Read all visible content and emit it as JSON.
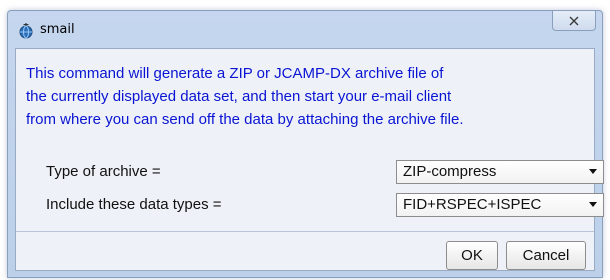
{
  "window": {
    "title": "smail",
    "close_icon": "close-x-icon",
    "app_icon": "smail-globe-icon"
  },
  "message": {
    "lines": [
      "This command will generate a ZIP or JCAMP-DX archive file of",
      "the currently displayed data set, and then start your e-mail client",
      "from where you can send off the data by attaching the archive file."
    ],
    "color": "#0a14d2"
  },
  "fields": {
    "archive_type": {
      "label": "Type of archive =",
      "value": "ZIP-compress"
    },
    "data_types": {
      "label": "Include these data types =",
      "value": "FID+RSPEC+ISPEC"
    }
  },
  "buttons": {
    "ok": "OK",
    "cancel": "Cancel"
  }
}
